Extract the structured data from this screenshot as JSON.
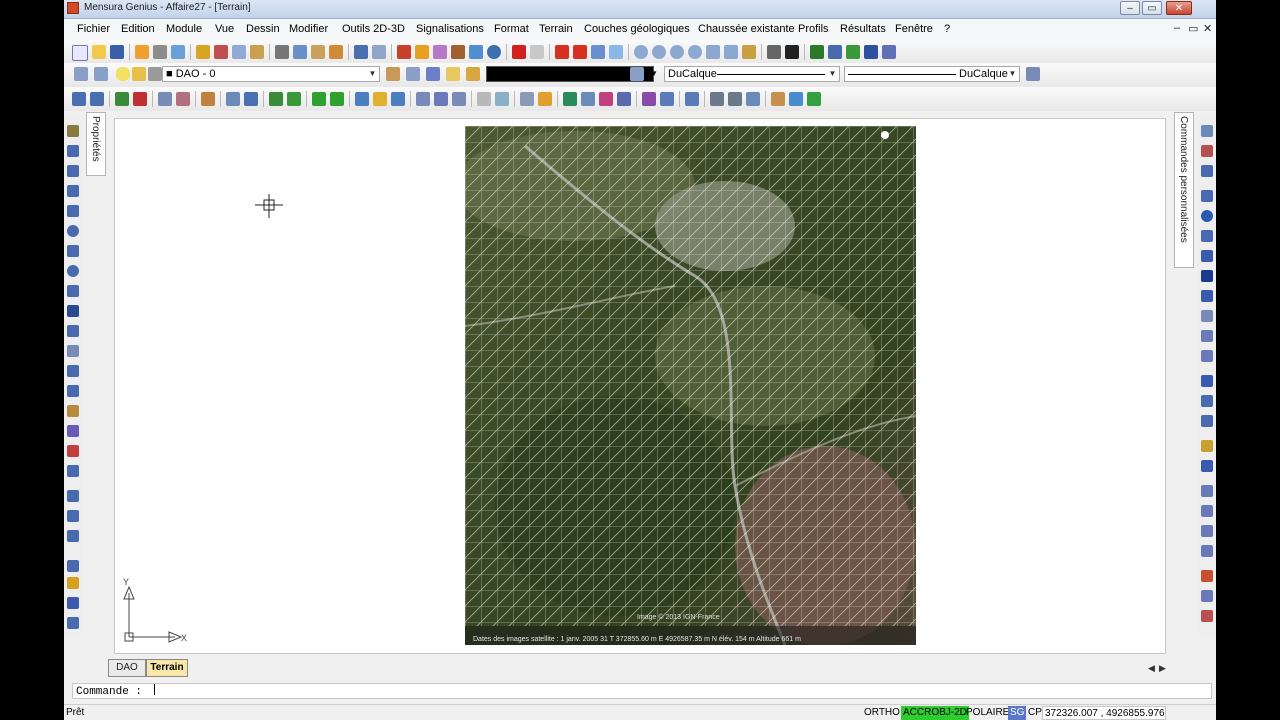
{
  "titlebar": {
    "title": "Mensura Genius - Affaire27 - [Terrain]",
    "controls": [
      "–",
      "▭",
      "✕"
    ]
  },
  "menubar": {
    "items": [
      "Fichier",
      "Edition",
      "Module",
      "Vue",
      "Dessin",
      "Modifier",
      "Outils 2D-3D",
      "Signalisations",
      "Format",
      "Terrain",
      "Couches géologiques",
      "Chaussée existante",
      "Profils",
      "Résultats",
      "Fenêtre",
      "?"
    ],
    "mdi_controls": [
      "–",
      "▭",
      "✕"
    ]
  },
  "toolbar2": {
    "layer_combo": "■ DAO - 0",
    "linetype_combo": "DuCalque",
    "lineweight_combo": "DuCalque"
  },
  "side_panels": {
    "left_tab": "Propriétés",
    "right_tab": "Commandes personnalisées"
  },
  "drawing": {
    "image_caption": "Dates des images satellite : 1 janv. 2005   31 T 372855.60 m E 4926587.35 m N    élév. 154 m   Altitude   661 m",
    "image_copyright": "Image © 2013 IGN-France",
    "ucs": {
      "x_label": "X",
      "y_label": "Y"
    }
  },
  "layout_tabs": [
    {
      "label": "DAO",
      "active": false
    },
    {
      "label": "Terrain",
      "active": true
    }
  ],
  "tab_nav": {
    "prev": "◀",
    "next": "▶"
  },
  "command_line": {
    "prompt": "Commande :"
  },
  "statusbar": {
    "ready": "Prêt",
    "ortho": "ORTHO",
    "accrobj": "ACCROBJ-2D",
    "polaire": "POLAIRE",
    "sg": "SG",
    "cp": "CP",
    "coords": "372326.007 , 4926855.976"
  },
  "colors": {
    "accrobj_bg": "#2ecc2e",
    "sg_bg": "#5a78c8",
    "active_tab_bg": "#f8e7a8"
  },
  "icons": {
    "toolbar1": [
      "new-file-icon",
      "open-folder-icon",
      "save-icon",
      "print-icon",
      "preview-icon",
      "publish-icon",
      "cut-icon",
      "copy-icon",
      "paste-icon",
      "match-properties-icon",
      "undo-icon",
      "redo-icon",
      "pan-icon",
      "zoom-in-icon",
      "zoom-out-icon",
      "zoom-window-icon",
      "zoom-extents-icon"
    ],
    "crosshair": "crosshair-icon"
  }
}
